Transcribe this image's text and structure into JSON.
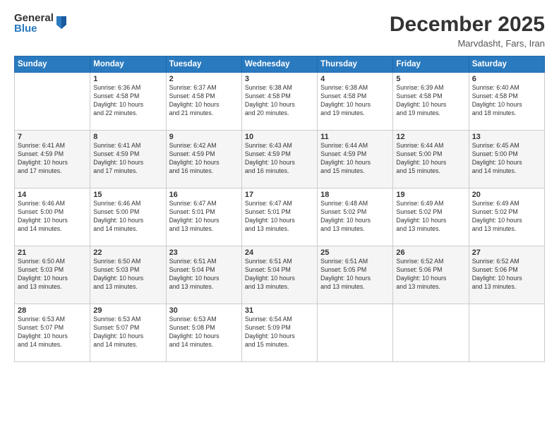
{
  "header": {
    "logo_general": "General",
    "logo_blue": "Blue",
    "month_year": "December 2025",
    "location": "Marvdasht, Fars, Iran"
  },
  "weekdays": [
    "Sunday",
    "Monday",
    "Tuesday",
    "Wednesday",
    "Thursday",
    "Friday",
    "Saturday"
  ],
  "weeks": [
    [
      {
        "day": "",
        "info": ""
      },
      {
        "day": "1",
        "info": "Sunrise: 6:36 AM\nSunset: 4:58 PM\nDaylight: 10 hours\nand 22 minutes."
      },
      {
        "day": "2",
        "info": "Sunrise: 6:37 AM\nSunset: 4:58 PM\nDaylight: 10 hours\nand 21 minutes."
      },
      {
        "day": "3",
        "info": "Sunrise: 6:38 AM\nSunset: 4:58 PM\nDaylight: 10 hours\nand 20 minutes."
      },
      {
        "day": "4",
        "info": "Sunrise: 6:38 AM\nSunset: 4:58 PM\nDaylight: 10 hours\nand 19 minutes."
      },
      {
        "day": "5",
        "info": "Sunrise: 6:39 AM\nSunset: 4:58 PM\nDaylight: 10 hours\nand 19 minutes."
      },
      {
        "day": "6",
        "info": "Sunrise: 6:40 AM\nSunset: 4:58 PM\nDaylight: 10 hours\nand 18 minutes."
      }
    ],
    [
      {
        "day": "7",
        "info": "Sunrise: 6:41 AM\nSunset: 4:59 PM\nDaylight: 10 hours\nand 17 minutes."
      },
      {
        "day": "8",
        "info": "Sunrise: 6:41 AM\nSunset: 4:59 PM\nDaylight: 10 hours\nand 17 minutes."
      },
      {
        "day": "9",
        "info": "Sunrise: 6:42 AM\nSunset: 4:59 PM\nDaylight: 10 hours\nand 16 minutes."
      },
      {
        "day": "10",
        "info": "Sunrise: 6:43 AM\nSunset: 4:59 PM\nDaylight: 10 hours\nand 16 minutes."
      },
      {
        "day": "11",
        "info": "Sunrise: 6:44 AM\nSunset: 4:59 PM\nDaylight: 10 hours\nand 15 minutes."
      },
      {
        "day": "12",
        "info": "Sunrise: 6:44 AM\nSunset: 5:00 PM\nDaylight: 10 hours\nand 15 minutes."
      },
      {
        "day": "13",
        "info": "Sunrise: 6:45 AM\nSunset: 5:00 PM\nDaylight: 10 hours\nand 14 minutes."
      }
    ],
    [
      {
        "day": "14",
        "info": "Sunrise: 6:46 AM\nSunset: 5:00 PM\nDaylight: 10 hours\nand 14 minutes."
      },
      {
        "day": "15",
        "info": "Sunrise: 6:46 AM\nSunset: 5:00 PM\nDaylight: 10 hours\nand 14 minutes."
      },
      {
        "day": "16",
        "info": "Sunrise: 6:47 AM\nSunset: 5:01 PM\nDaylight: 10 hours\nand 13 minutes."
      },
      {
        "day": "17",
        "info": "Sunrise: 6:47 AM\nSunset: 5:01 PM\nDaylight: 10 hours\nand 13 minutes."
      },
      {
        "day": "18",
        "info": "Sunrise: 6:48 AM\nSunset: 5:02 PM\nDaylight: 10 hours\nand 13 minutes."
      },
      {
        "day": "19",
        "info": "Sunrise: 6:49 AM\nSunset: 5:02 PM\nDaylight: 10 hours\nand 13 minutes."
      },
      {
        "day": "20",
        "info": "Sunrise: 6:49 AM\nSunset: 5:02 PM\nDaylight: 10 hours\nand 13 minutes."
      }
    ],
    [
      {
        "day": "21",
        "info": "Sunrise: 6:50 AM\nSunset: 5:03 PM\nDaylight: 10 hours\nand 13 minutes."
      },
      {
        "day": "22",
        "info": "Sunrise: 6:50 AM\nSunset: 5:03 PM\nDaylight: 10 hours\nand 13 minutes."
      },
      {
        "day": "23",
        "info": "Sunrise: 6:51 AM\nSunset: 5:04 PM\nDaylight: 10 hours\nand 13 minutes."
      },
      {
        "day": "24",
        "info": "Sunrise: 6:51 AM\nSunset: 5:04 PM\nDaylight: 10 hours\nand 13 minutes."
      },
      {
        "day": "25",
        "info": "Sunrise: 6:51 AM\nSunset: 5:05 PM\nDaylight: 10 hours\nand 13 minutes."
      },
      {
        "day": "26",
        "info": "Sunrise: 6:52 AM\nSunset: 5:06 PM\nDaylight: 10 hours\nand 13 minutes."
      },
      {
        "day": "27",
        "info": "Sunrise: 6:52 AM\nSunset: 5:06 PM\nDaylight: 10 hours\nand 13 minutes."
      }
    ],
    [
      {
        "day": "28",
        "info": "Sunrise: 6:53 AM\nSunset: 5:07 PM\nDaylight: 10 hours\nand 14 minutes."
      },
      {
        "day": "29",
        "info": "Sunrise: 6:53 AM\nSunset: 5:07 PM\nDaylight: 10 hours\nand 14 minutes."
      },
      {
        "day": "30",
        "info": "Sunrise: 6:53 AM\nSunset: 5:08 PM\nDaylight: 10 hours\nand 14 minutes."
      },
      {
        "day": "31",
        "info": "Sunrise: 6:54 AM\nSunset: 5:09 PM\nDaylight: 10 hours\nand 15 minutes."
      },
      {
        "day": "",
        "info": ""
      },
      {
        "day": "",
        "info": ""
      },
      {
        "day": "",
        "info": ""
      }
    ]
  ]
}
